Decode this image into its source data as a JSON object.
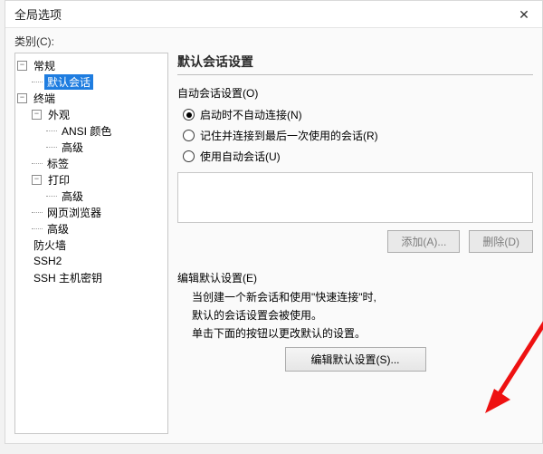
{
  "window": {
    "title": "全局选项"
  },
  "category_label": "类别(C):",
  "tree": {
    "n0": "常规",
    "n0_0": "默认会话",
    "n1": "终端",
    "n1_0": "外观",
    "n1_0_0": "ANSI 颜色",
    "n1_0_1": "高级",
    "n1_1": "标签",
    "n1_2": "打印",
    "n1_2_0": "高级",
    "n1_3": "网页浏览器",
    "n1_4": "高级",
    "n2": "防火墙",
    "n3": "SSH2",
    "n4": "SSH 主机密钥"
  },
  "section_title": "默认会话设置",
  "auto_group_label": "自动会话设置(O)",
  "radios": {
    "r1": "启动时不自动连接(N)",
    "r2": "记住并连接到最后一次使用的会话(R)",
    "r3": "使用自动会话(U)"
  },
  "buttons": {
    "add": "添加(A)...",
    "del": "删除(D)"
  },
  "edit_group_label": "编辑默认设置(E)",
  "edit_desc_l1": "当创建一个新会话和使用\"快速连接\"时,",
  "edit_desc_l2": "默认的会话设置会被使用。",
  "edit_desc_l3": "单击下面的按钮以更改默认的设置。",
  "edit_button": "编辑默认设置(S)..."
}
